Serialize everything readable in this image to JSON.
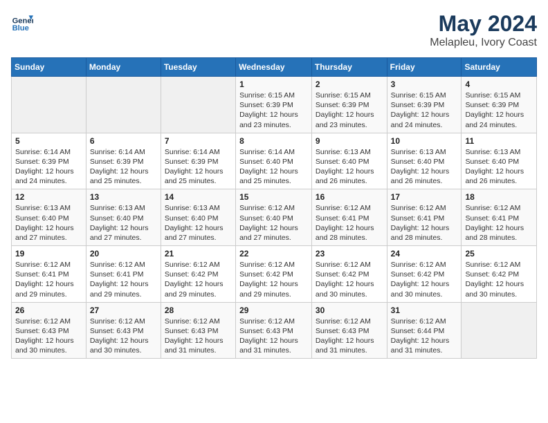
{
  "header": {
    "logo_line1": "General",
    "logo_line2": "Blue",
    "month": "May 2024",
    "location": "Melapleu, Ivory Coast"
  },
  "weekdays": [
    "Sunday",
    "Monday",
    "Tuesday",
    "Wednesday",
    "Thursday",
    "Friday",
    "Saturday"
  ],
  "weeks": [
    [
      {
        "day": "",
        "info": ""
      },
      {
        "day": "",
        "info": ""
      },
      {
        "day": "",
        "info": ""
      },
      {
        "day": "1",
        "info": "Sunrise: 6:15 AM\nSunset: 6:39 PM\nDaylight: 12 hours\nand 23 minutes."
      },
      {
        "day": "2",
        "info": "Sunrise: 6:15 AM\nSunset: 6:39 PM\nDaylight: 12 hours\nand 23 minutes."
      },
      {
        "day": "3",
        "info": "Sunrise: 6:15 AM\nSunset: 6:39 PM\nDaylight: 12 hours\nand 24 minutes."
      },
      {
        "day": "4",
        "info": "Sunrise: 6:15 AM\nSunset: 6:39 PM\nDaylight: 12 hours\nand 24 minutes."
      }
    ],
    [
      {
        "day": "5",
        "info": "Sunrise: 6:14 AM\nSunset: 6:39 PM\nDaylight: 12 hours\nand 24 minutes."
      },
      {
        "day": "6",
        "info": "Sunrise: 6:14 AM\nSunset: 6:39 PM\nDaylight: 12 hours\nand 25 minutes."
      },
      {
        "day": "7",
        "info": "Sunrise: 6:14 AM\nSunset: 6:39 PM\nDaylight: 12 hours\nand 25 minutes."
      },
      {
        "day": "8",
        "info": "Sunrise: 6:14 AM\nSunset: 6:40 PM\nDaylight: 12 hours\nand 25 minutes."
      },
      {
        "day": "9",
        "info": "Sunrise: 6:13 AM\nSunset: 6:40 PM\nDaylight: 12 hours\nand 26 minutes."
      },
      {
        "day": "10",
        "info": "Sunrise: 6:13 AM\nSunset: 6:40 PM\nDaylight: 12 hours\nand 26 minutes."
      },
      {
        "day": "11",
        "info": "Sunrise: 6:13 AM\nSunset: 6:40 PM\nDaylight: 12 hours\nand 26 minutes."
      }
    ],
    [
      {
        "day": "12",
        "info": "Sunrise: 6:13 AM\nSunset: 6:40 PM\nDaylight: 12 hours\nand 27 minutes."
      },
      {
        "day": "13",
        "info": "Sunrise: 6:13 AM\nSunset: 6:40 PM\nDaylight: 12 hours\nand 27 minutes."
      },
      {
        "day": "14",
        "info": "Sunrise: 6:13 AM\nSunset: 6:40 PM\nDaylight: 12 hours\nand 27 minutes."
      },
      {
        "day": "15",
        "info": "Sunrise: 6:12 AM\nSunset: 6:40 PM\nDaylight: 12 hours\nand 27 minutes."
      },
      {
        "day": "16",
        "info": "Sunrise: 6:12 AM\nSunset: 6:41 PM\nDaylight: 12 hours\nand 28 minutes."
      },
      {
        "day": "17",
        "info": "Sunrise: 6:12 AM\nSunset: 6:41 PM\nDaylight: 12 hours\nand 28 minutes."
      },
      {
        "day": "18",
        "info": "Sunrise: 6:12 AM\nSunset: 6:41 PM\nDaylight: 12 hours\nand 28 minutes."
      }
    ],
    [
      {
        "day": "19",
        "info": "Sunrise: 6:12 AM\nSunset: 6:41 PM\nDaylight: 12 hours\nand 29 minutes."
      },
      {
        "day": "20",
        "info": "Sunrise: 6:12 AM\nSunset: 6:41 PM\nDaylight: 12 hours\nand 29 minutes."
      },
      {
        "day": "21",
        "info": "Sunrise: 6:12 AM\nSunset: 6:42 PM\nDaylight: 12 hours\nand 29 minutes."
      },
      {
        "day": "22",
        "info": "Sunrise: 6:12 AM\nSunset: 6:42 PM\nDaylight: 12 hours\nand 29 minutes."
      },
      {
        "day": "23",
        "info": "Sunrise: 6:12 AM\nSunset: 6:42 PM\nDaylight: 12 hours\nand 30 minutes."
      },
      {
        "day": "24",
        "info": "Sunrise: 6:12 AM\nSunset: 6:42 PM\nDaylight: 12 hours\nand 30 minutes."
      },
      {
        "day": "25",
        "info": "Sunrise: 6:12 AM\nSunset: 6:42 PM\nDaylight: 12 hours\nand 30 minutes."
      }
    ],
    [
      {
        "day": "26",
        "info": "Sunrise: 6:12 AM\nSunset: 6:43 PM\nDaylight: 12 hours\nand 30 minutes."
      },
      {
        "day": "27",
        "info": "Sunrise: 6:12 AM\nSunset: 6:43 PM\nDaylight: 12 hours\nand 30 minutes."
      },
      {
        "day": "28",
        "info": "Sunrise: 6:12 AM\nSunset: 6:43 PM\nDaylight: 12 hours\nand 31 minutes."
      },
      {
        "day": "29",
        "info": "Sunrise: 6:12 AM\nSunset: 6:43 PM\nDaylight: 12 hours\nand 31 minutes."
      },
      {
        "day": "30",
        "info": "Sunrise: 6:12 AM\nSunset: 6:43 PM\nDaylight: 12 hours\nand 31 minutes."
      },
      {
        "day": "31",
        "info": "Sunrise: 6:12 AM\nSunset: 6:44 PM\nDaylight: 12 hours\nand 31 minutes."
      },
      {
        "day": "",
        "info": ""
      }
    ]
  ]
}
